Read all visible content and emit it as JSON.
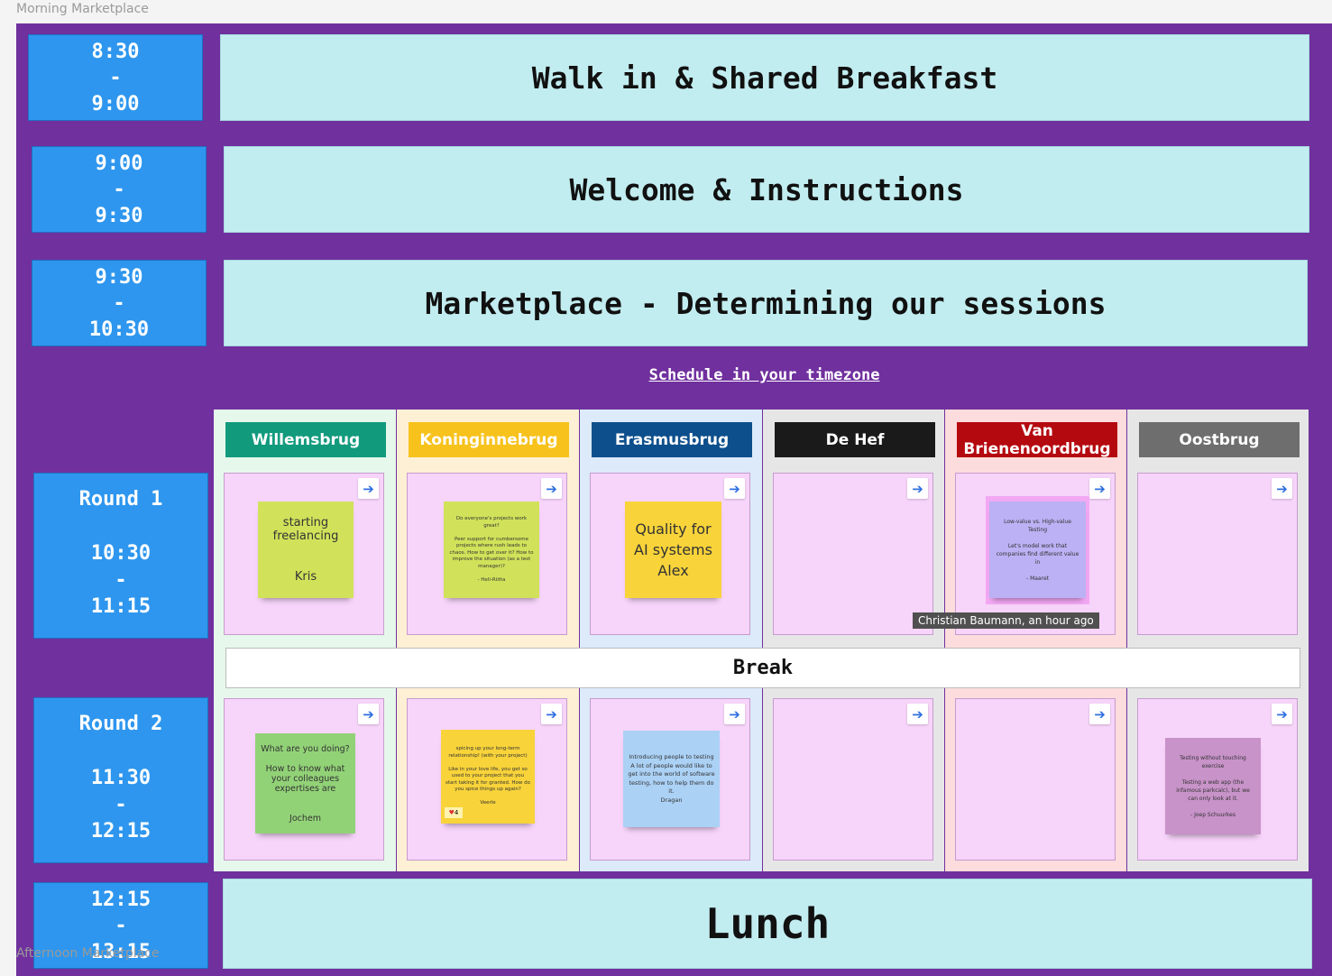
{
  "frame_titles": {
    "top": "Morning Marketplace",
    "bottom": "Afternoon Marketplace"
  },
  "schedule": [
    {
      "start": "8:30",
      "sep": "-",
      "end": "9:00",
      "title": "Walk in & Shared Breakfast"
    },
    {
      "start": "9:00",
      "sep": "-",
      "end": "9:30",
      "title": "Welcome & Instructions"
    },
    {
      "start": "9:30",
      "sep": "-",
      "end": "10:30",
      "title": "Marketplace - Determining our sessions"
    }
  ],
  "timezone_link": "Schedule in your timezone",
  "rooms": [
    {
      "name": "Willemsbrug",
      "header_color": "#129a7d",
      "column_bg": "#e6f8ec"
    },
    {
      "name": "Koninginnebrug",
      "header_color": "#f7c21b",
      "column_bg": "#fdf0d5"
    },
    {
      "name": "Erasmusbrug",
      "header_color": "#0d4f8c",
      "column_bg": "#dceaf9"
    },
    {
      "name": "De Hef",
      "header_color": "#1a1a1a",
      "column_bg": "#e6e6e6"
    },
    {
      "name": "Van Brienenoordbrug",
      "header_color": "#b4090f",
      "column_bg": "#fcdcdc"
    },
    {
      "name": "Oostbrug",
      "header_color": "#6e6e6e",
      "column_bg": "#e6e6e6"
    }
  ],
  "rounds": [
    {
      "label": "Round 1",
      "start": "10:30",
      "sep": "-",
      "end": "11:15"
    },
    {
      "label": "Round 2",
      "start": "11:30",
      "sep": "-",
      "end": "12:15"
    }
  ],
  "break_label": "Break",
  "stickies": {
    "r1_willemsbrug": "starting\nfreelancing\n\n\nKris",
    "r1_koninginnebrug": "Do everyone's projects work great?\n\nPeer support for cumbersome projects where rush leads to chaos. How to get over it? How to improve the situation (as a test manager)?\n\n- Heli-Riitta",
    "r1_erasmusbrug": "Quality for\nAI systems\nAlex",
    "r1_vanbrienenoordbrug": "Low-value vs. High-value Testing\n\nLet's model work that companies find different value in\n\n- Maaret",
    "r2_willemsbrug": "What are you doing?\n\nHow to know what your colleagues expertises are\n\n\nJochem",
    "r2_koninginnebrug": "spicing up your long-term relationship! (with your project)\n\nLike in your love life, you get so used to your project that you start taking it for granted. How do you spice things up again?\n\nVeerle",
    "r2_koninginnebrug_reaction": "4",
    "r2_erasmusbrug": "Introducing people to testing\nA lot of people would like to get into the world of software testing, how to help them do it.\nDragan",
    "r2_oostbrug": "Testing without touching exercise\n\nTesting a web app (the infamous parkcalc), but we can only look at it.\n\n- Joep Schuurkes"
  },
  "tooltip": "Christian Baumann, an hour ago",
  "lunch": {
    "start": "12:15",
    "sep": "-",
    "end": "13:15",
    "title": "Lunch"
  },
  "colors": {
    "frame": "#70309e",
    "time_block": "#2e96ee",
    "banner": "#c2edf0",
    "slot": "#f7d4fa"
  },
  "icons": {
    "slot_action": "arrow-right-icon"
  }
}
